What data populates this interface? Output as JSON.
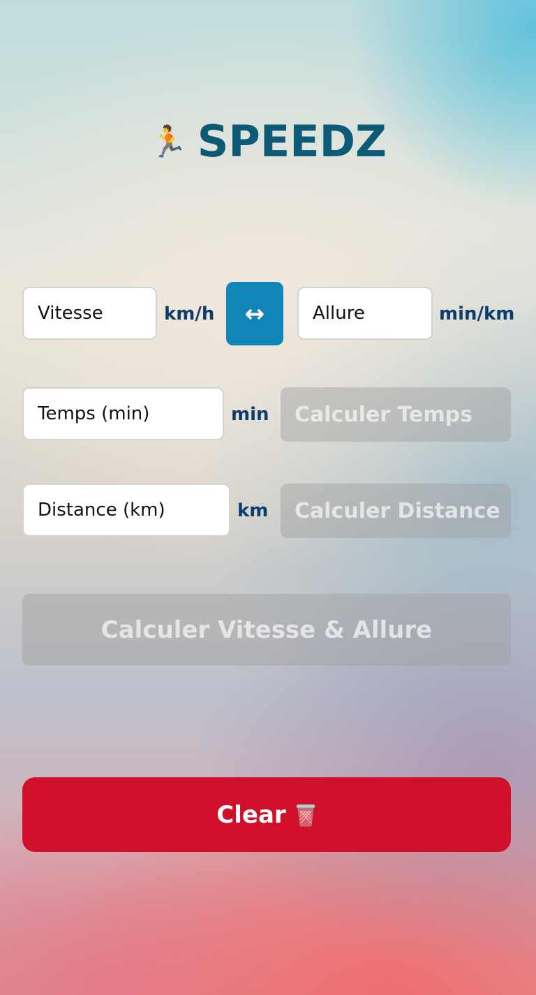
{
  "app": {
    "title": "SPEEDZ",
    "title_icon": "🏃",
    "title_icon_name": "runner-icon"
  },
  "speed_row": {
    "speed_placeholder": "Vitesse",
    "speed_unit": "km/h",
    "swap_label": "↔",
    "pace_placeholder": "Allure",
    "pace_unit": "min/km"
  },
  "time_row": {
    "time_placeholder": "Temps (min)",
    "time_unit": "min",
    "calc_time_label": "Calculer Temps"
  },
  "distance_row": {
    "distance_placeholder": "Distance (km)",
    "distance_unit": "km",
    "calc_distance_label": "Calculer Distance"
  },
  "calc_speed_pace_label": "Calculer Vitesse & Allure",
  "clear": {
    "label": "Clear",
    "icon_name": "trash-icon"
  },
  "colors": {
    "title": "#0c5a75",
    "unit": "#0e3d6b",
    "swap_button": "#1185b7",
    "clear_button": "#d0102a",
    "disabled_button": "#a0a0a0"
  }
}
